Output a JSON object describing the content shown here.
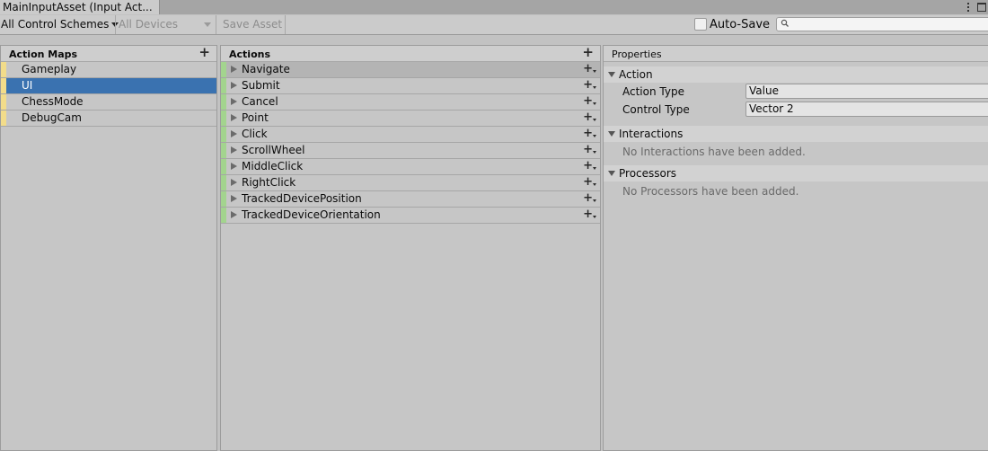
{
  "window": {
    "tab_title": "MainInputAsset (Input Act..."
  },
  "toolbar": {
    "control_schemes": "All Control Schemes",
    "devices": "All Devices",
    "save_asset": "Save Asset",
    "auto_save_label": "Auto-Save",
    "auto_save_checked": false,
    "search_placeholder": ""
  },
  "action_maps": {
    "title": "Action Maps",
    "items": [
      {
        "label": "Gameplay",
        "selected": false
      },
      {
        "label": "UI",
        "selected": true
      },
      {
        "label": "ChessMode",
        "selected": false
      },
      {
        "label": "DebugCam",
        "selected": false
      }
    ]
  },
  "actions": {
    "title": "Actions",
    "items": [
      {
        "label": "Navigate"
      },
      {
        "label": "Submit"
      },
      {
        "label": "Cancel"
      },
      {
        "label": "Point"
      },
      {
        "label": "Click"
      },
      {
        "label": "ScrollWheel"
      },
      {
        "label": "MiddleClick"
      },
      {
        "label": "RightClick"
      },
      {
        "label": "TrackedDevicePosition"
      },
      {
        "label": "TrackedDeviceOrientation"
      }
    ]
  },
  "properties": {
    "title": "Properties",
    "action_section": "Action",
    "action_type_label": "Action Type",
    "action_type_value": "Value",
    "control_type_label": "Control Type",
    "control_type_value": "Vector 2",
    "interactions_section": "Interactions",
    "interactions_empty": "No Interactions have been added.",
    "processors_section": "Processors",
    "processors_empty": "No Processors have been added."
  },
  "colors": {
    "selection": "#3a72b0",
    "action_map_stripe": "#f2dc8a",
    "action_stripe": "#a3d48e"
  }
}
